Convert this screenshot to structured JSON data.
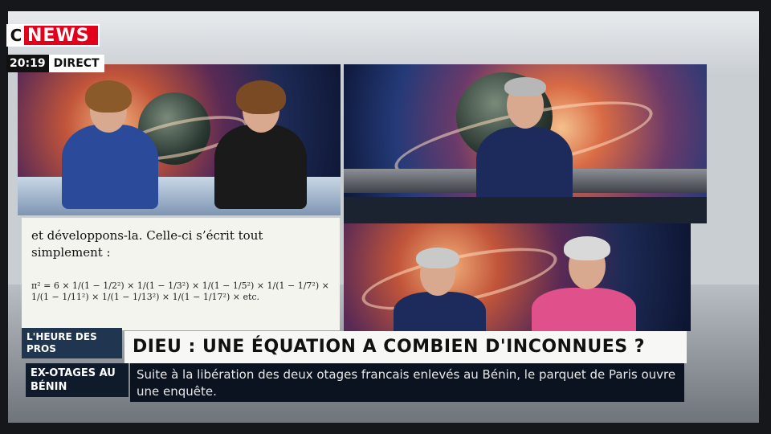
{
  "channel": {
    "logo_c": "C",
    "logo_news": "NEWS",
    "time": "20:19",
    "live": "DIRECT"
  },
  "equation": {
    "text": "et développons-la. Celle-ci s’écrit tout simplement :",
    "formula": "π² = 6 × 1/(1 − 1/2²) × 1/(1 − 1/3²) × 1/(1 − 1/5²) × 1/(1 − 1/7²) × 1/(1 − 1/11²) × 1/(1 − 1/13²) × 1/(1 − 1/17²) × etc."
  },
  "lower_third": {
    "show_tag": "L'HEURE DES PROS",
    "headline": "DIEU : UNE ÉQUATION A COMBIEN D'INCONNUES ?",
    "ticker_tag": "EX-OTAGES AU BÉNIN",
    "ticker_text": "Suite à la libération des deux otages francais enlevés au Bénin, le parquet de Paris ouvre une enquête."
  },
  "colors": {
    "brand": "#e3001b",
    "banner_dark": "#1f3550",
    "ticker_bg": "#0b1220"
  }
}
